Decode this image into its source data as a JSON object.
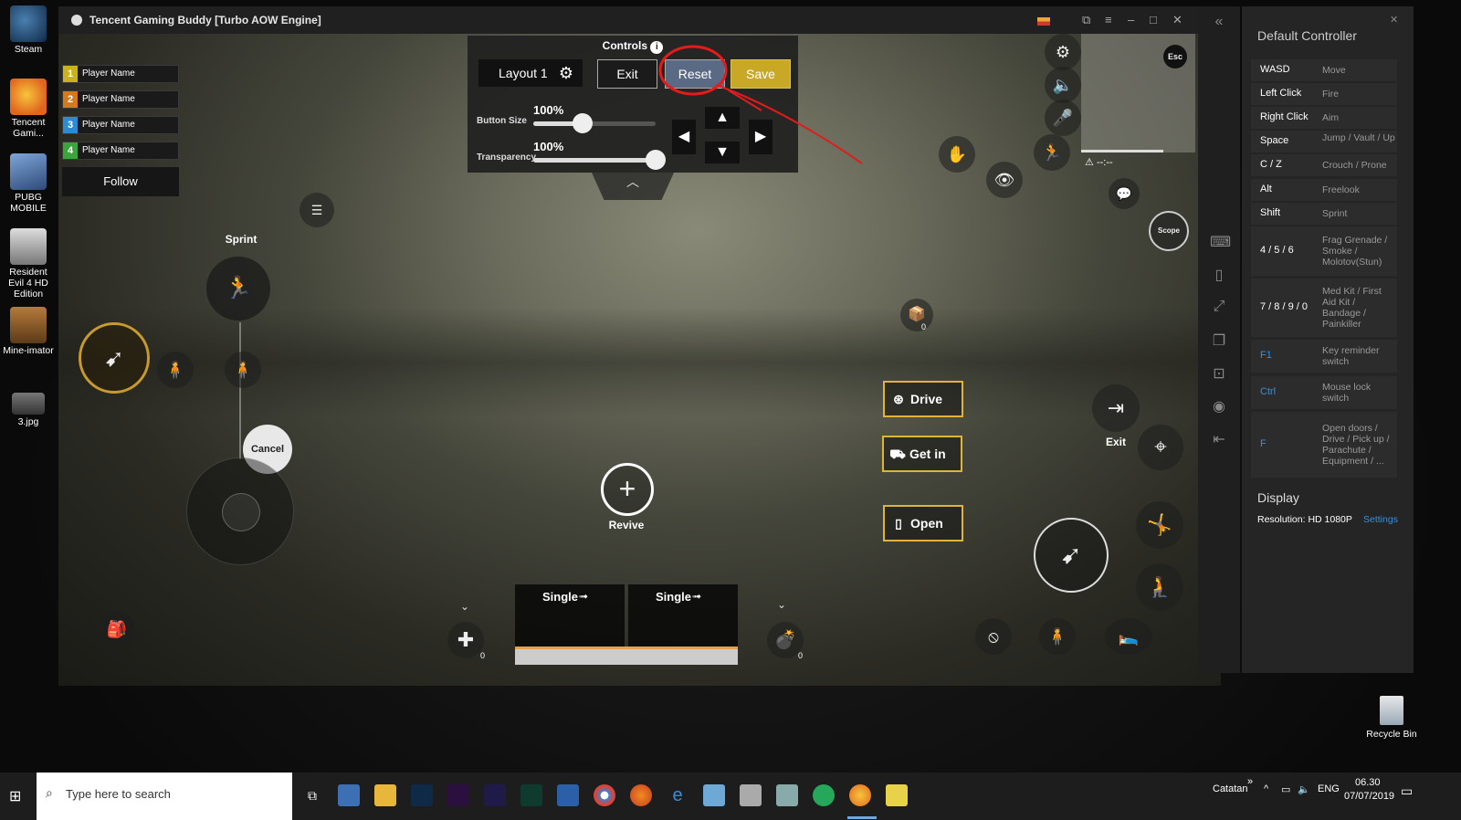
{
  "desktop": {
    "icons": [
      {
        "label": "Steam"
      },
      {
        "label": "Tencent Gami..."
      },
      {
        "label": "PUBG MOBILE"
      },
      {
        "label": "Resident Evil 4 HD Edition"
      },
      {
        "label": "Mine-imator"
      },
      {
        "label": "3.jpg"
      }
    ],
    "recycle_bin": "Recycle Bin"
  },
  "window": {
    "title": "Tencent Gaming Buddy [Turbo AOW Engine]"
  },
  "game": {
    "players": [
      {
        "num": "1",
        "name": "Player Name",
        "color": "#c9b21f"
      },
      {
        "num": "2",
        "name": "Player Name",
        "color": "#d27a1c"
      },
      {
        "num": "3",
        "name": "Player Name",
        "color": "#2a8bd6"
      },
      {
        "num": "4",
        "name": "Player Name",
        "color": "#3aa53a"
      }
    ],
    "follow": "Follow",
    "controls": {
      "caption": "Controls",
      "layout": "Layout 1",
      "exit": "Exit",
      "reset": "Reset",
      "save": "Save",
      "button_size_label": "Button Size",
      "button_size_value": "100%",
      "button_size_level": 0.4,
      "transparency_label": "Transparency",
      "transparency_value": "100%",
      "transparency_level": 1.0
    },
    "esc": "Esc",
    "scope": "Scope",
    "sprint": "Sprint",
    "cancel": "Cancel",
    "revive": "Revive",
    "drive": "Drive",
    "get_in": "Get in",
    "open": "Open",
    "exit_vehicle": "Exit",
    "weapon1": "Single",
    "weapon2": "Single",
    "medkit_count": "0",
    "grenade_count": "0",
    "loot_count": "0",
    "minimap_text": "--:--"
  },
  "side_panel": {
    "title": "Default Controller",
    "keys": [
      {
        "key": "WASD",
        "action": "Move"
      },
      {
        "key": "Left Click",
        "action": "Fire"
      },
      {
        "key": "Right Click",
        "action": "Aim"
      },
      {
        "key": "Space",
        "action": "Jump / Vault / Up"
      },
      {
        "key": "C / Z",
        "action": "Crouch / Prone"
      },
      {
        "key": "Alt",
        "action": "Freelook"
      },
      {
        "key": "Shift",
        "action": "Sprint"
      },
      {
        "key": "4 / 5 / 6",
        "action": "Frag Grenade / Smoke / Molotov(Stun)"
      },
      {
        "key": "7 / 8 / 9 / 0",
        "action": "Med Kit / First Aid Kit / Bandage / Painkiller"
      },
      {
        "key": "F1",
        "action": "Key reminder switch"
      },
      {
        "key": "Ctrl",
        "action": "Mouse lock switch"
      },
      {
        "key": "F",
        "action": "Open doors / Drive / Pick up / Parachute / Equipment / ..."
      }
    ],
    "display_title": "Display",
    "resolution": "Resolution: HD 1080P",
    "settings": "Settings"
  },
  "taskbar": {
    "search_placeholder": "Type here to search",
    "layout_label": "Catatan",
    "lang": "ENG",
    "time": "06.30",
    "date": "07/07/2019"
  },
  "colors": {
    "accent_reset": "#5a6a85",
    "save": "#c9a825",
    "highlight_button": "#e0b33a",
    "annotation": "#e21b1b"
  }
}
